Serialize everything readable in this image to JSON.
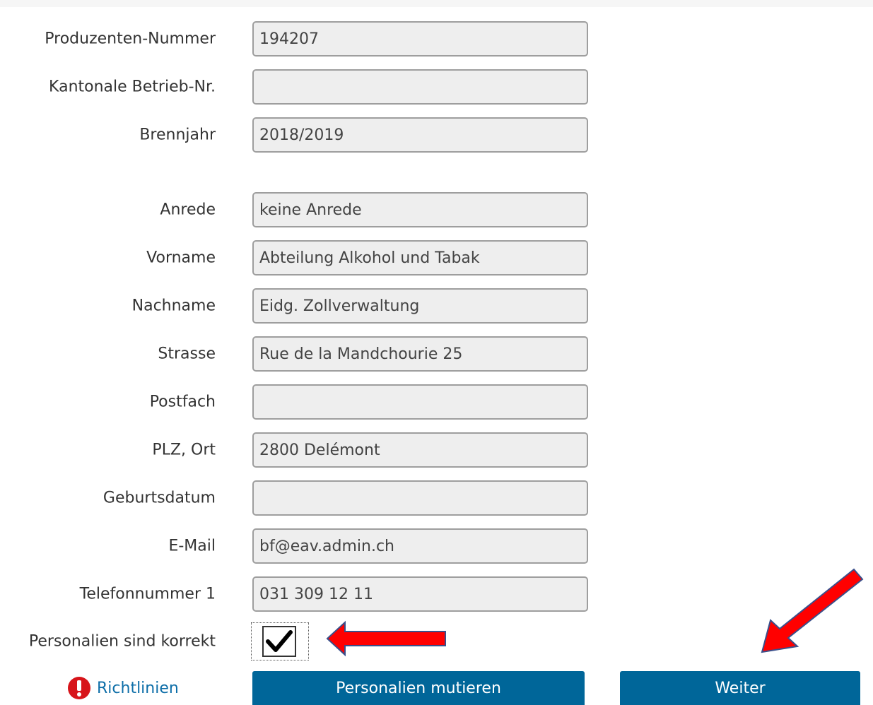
{
  "form": {
    "fields": [
      {
        "label": "Produzenten-Nummer",
        "value": "194207"
      },
      {
        "label": "Kantonale Betrieb-Nr.",
        "value": ""
      },
      {
        "label": "Brennjahr",
        "value": "2018/2019"
      },
      {
        "label": "Anrede",
        "value": "keine Anrede"
      },
      {
        "label": "Vorname",
        "value": "Abteilung Alkohol und Tabak"
      },
      {
        "label": "Nachname",
        "value": "Eidg. Zollverwaltung"
      },
      {
        "label": "Strasse",
        "value": "Rue de la Mandchourie 25"
      },
      {
        "label": "Postfach",
        "value": ""
      },
      {
        "label": "PLZ, Ort",
        "value": "2800 Delémont"
      },
      {
        "label": "Geburtsdatum",
        "value": ""
      },
      {
        "label": "E-Mail",
        "value": "bf@eav.admin.ch"
      },
      {
        "label": "Telefonnummer 1",
        "value": "031 309 12 11"
      }
    ],
    "confirm": {
      "label": "Personalien sind korrekt",
      "checked": true
    }
  },
  "links": {
    "richtlinien": "Richtlinien",
    "warning_icon": "exclamation-circle-icon"
  },
  "buttons": {
    "mutate": "Personalien mutieren",
    "next": "Weiter"
  },
  "colors": {
    "button_bg": "#006699",
    "annotation_arrow": "#ff0000",
    "warning_icon": "#d7141a",
    "link": "#0d6ea8"
  }
}
